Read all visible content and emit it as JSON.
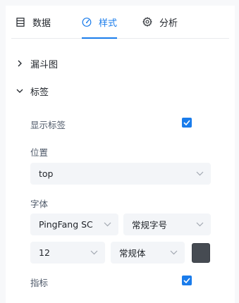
{
  "tabs": [
    {
      "label": "数据",
      "icon": "table-icon",
      "active": false
    },
    {
      "label": "样式",
      "icon": "gauge-icon",
      "active": true
    },
    {
      "label": "分析",
      "icon": "gear-icon",
      "active": false
    }
  ],
  "sections": {
    "funnel": {
      "title": "漏斗图",
      "expanded": false
    },
    "labels": {
      "title": "标签",
      "expanded": true
    }
  },
  "label_settings": {
    "show_labels": {
      "label": "显示标签",
      "checked": true
    },
    "position": {
      "label": "位置",
      "value": "top"
    },
    "font": {
      "label": "字体",
      "family": "PingFang SC",
      "size_preset": "常规字号",
      "size": "12",
      "weight": "常规体",
      "color": "#464b52"
    },
    "metric": {
      "label": "指标",
      "checked": true
    }
  },
  "colors": {
    "accent": "#1a7ceb",
    "select_bg": "#f3f5f8"
  }
}
